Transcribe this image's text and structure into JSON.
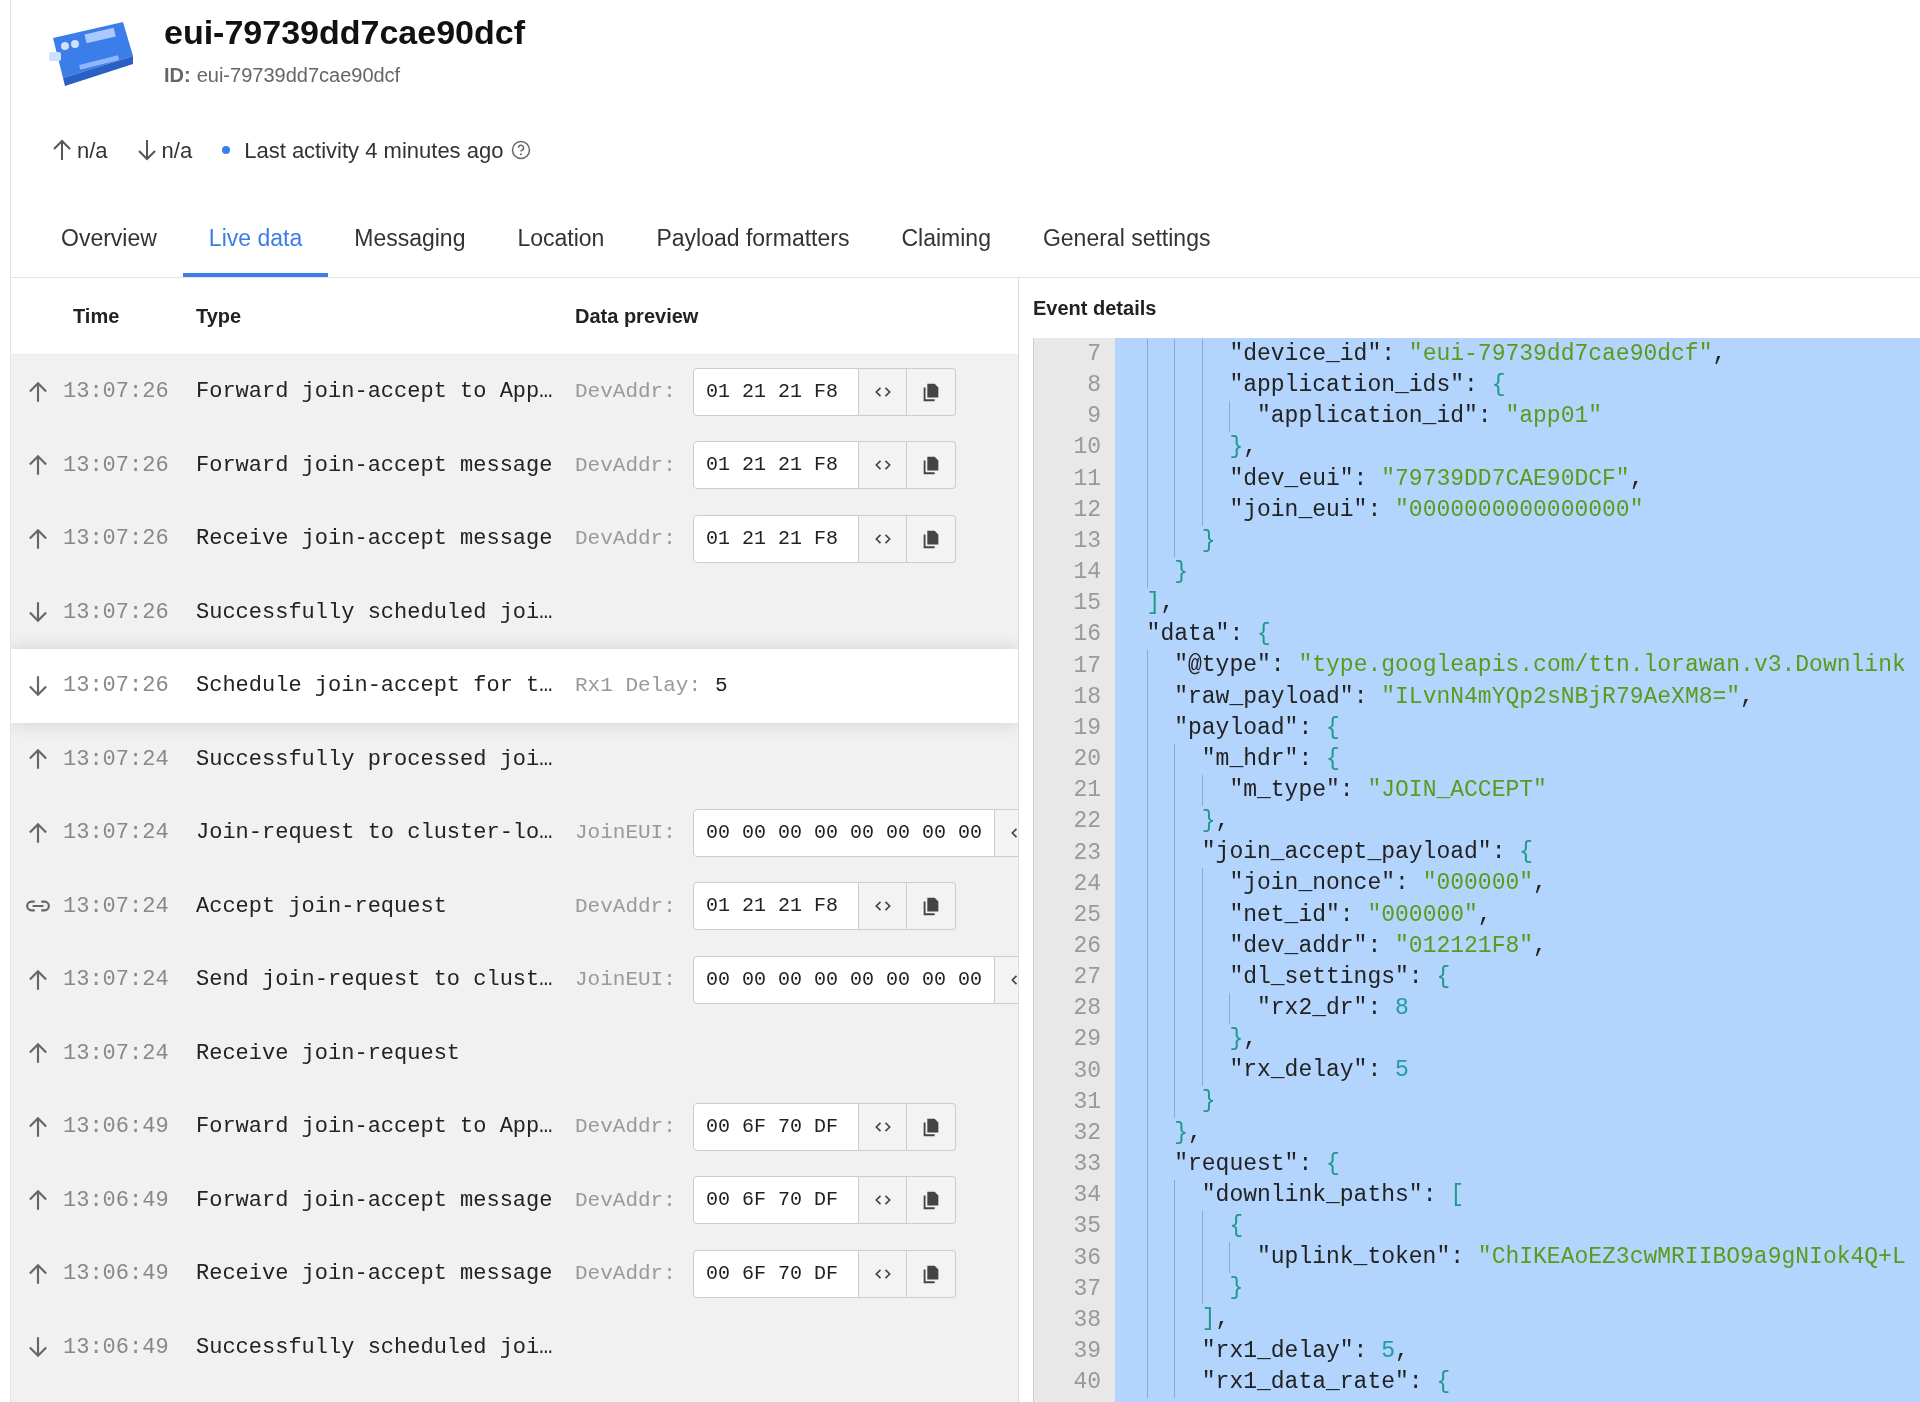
{
  "device": {
    "title": "eui-79739dd7cae90dcf",
    "id_label": "ID:",
    "id_value": "eui-79739dd7cae90dcf"
  },
  "stats": {
    "uplink": "n/a",
    "downlink": "n/a",
    "activity": "Last activity 4 minutes ago"
  },
  "tabs": [
    {
      "label": "Overview",
      "selected": false
    },
    {
      "label": "Live data",
      "selected": true
    },
    {
      "label": "Messaging",
      "selected": false
    },
    {
      "label": "Location",
      "selected": false
    },
    {
      "label": "Payload formatters",
      "selected": false
    },
    {
      "label": "Claiming",
      "selected": false
    },
    {
      "label": "General settings",
      "selected": false
    }
  ],
  "table": {
    "columns": [
      "Time",
      "Type",
      "Data preview"
    ],
    "rows": [
      {
        "kind": "up",
        "time": "13:07:26",
        "type": "Forward join-accept to App…",
        "preview": {
          "kind": "bytes",
          "label": "DevAddr:",
          "value": "01 21 21 F8"
        },
        "selected": false
      },
      {
        "kind": "up",
        "time": "13:07:26",
        "type": "Forward join-accept message",
        "preview": {
          "kind": "bytes",
          "label": "DevAddr:",
          "value": "01 21 21 F8"
        },
        "selected": false
      },
      {
        "kind": "up",
        "time": "13:07:26",
        "type": "Receive join-accept message",
        "preview": {
          "kind": "bytes",
          "label": "DevAddr:",
          "value": "01 21 21 F8"
        },
        "selected": false
      },
      {
        "kind": "down",
        "time": "13:07:26",
        "type": "Successfully scheduled joi…",
        "selected": false
      },
      {
        "kind": "down",
        "time": "13:07:26",
        "type": "Schedule join-accept for t…",
        "preview": {
          "kind": "text",
          "label": "Rx1 Delay:",
          "value": "5"
        },
        "selected": true
      },
      {
        "kind": "up",
        "time": "13:07:24",
        "type": "Successfully processed joi…",
        "selected": false
      },
      {
        "kind": "up",
        "time": "13:07:24",
        "type": "Join-request to cluster-lo…",
        "preview": {
          "kind": "eui",
          "label": "JoinEUI:",
          "value": "00 00 00 00 00 00 00 00"
        },
        "selected": false
      },
      {
        "kind": "link",
        "time": "13:07:24",
        "type": "Accept join-request",
        "preview": {
          "kind": "bytes",
          "label": "DevAddr:",
          "value": "01 21 21 F8"
        },
        "selected": false
      },
      {
        "kind": "up",
        "time": "13:07:24",
        "type": "Send join-request to clust…",
        "preview": {
          "kind": "eui",
          "label": "JoinEUI:",
          "value": "00 00 00 00 00 00 00 00"
        },
        "selected": false
      },
      {
        "kind": "up",
        "time": "13:07:24",
        "type": "Receive join-request",
        "selected": false
      },
      {
        "kind": "up",
        "time": "13:06:49",
        "type": "Forward join-accept to App…",
        "preview": {
          "kind": "bytes",
          "label": "DevAddr:",
          "value": "00 6F 70 DF"
        },
        "selected": false
      },
      {
        "kind": "up",
        "time": "13:06:49",
        "type": "Forward join-accept message",
        "preview": {
          "kind": "bytes",
          "label": "DevAddr:",
          "value": "00 6F 70 DF"
        },
        "selected": false
      },
      {
        "kind": "up",
        "time": "13:06:49",
        "type": "Receive join-accept message",
        "preview": {
          "kind": "bytes",
          "label": "DevAddr:",
          "value": "00 6F 70 DF"
        },
        "selected": false
      },
      {
        "kind": "down",
        "time": "13:06:49",
        "type": "Successfully scheduled joi…",
        "selected": false
      }
    ]
  },
  "event_details": {
    "title": "Event details",
    "lines": [
      {
        "children": [
          {
            "children": [
              {
                "children": [
                  {
                    "number": "7",
                    "tokens": [
                      {
                        "kind": "key",
                        "text": "\"device_id\""
                      },
                      {
                        "kind": "punct",
                        "text": ":"
                      },
                      {
                        "kind": "str",
                        "text": "\"eui-79739dd7cae90dcf\""
                      },
                      {
                        "kind": "punct",
                        "text": ","
                      }
                    ]
                  },
                  {
                    "number": "8",
                    "tokens": [
                      {
                        "kind": "key",
                        "text": "\"application_ids\""
                      },
                      {
                        "kind": "punct",
                        "text": ":"
                      },
                      {
                        "kind": "brace",
                        "text": "{"
                      }
                    ],
                    "children": [
                      {
                        "number": "9",
                        "tokens": [
                          {
                            "kind": "key",
                            "text": "\"application_id\""
                          },
                          {
                            "kind": "punct",
                            "text": ":"
                          },
                          {
                            "kind": "str",
                            "text": "\"app01\""
                          }
                        ]
                      }
                    ]
                  },
                  {
                    "number": "10",
                    "tokens": [
                      {
                        "kind": "brace",
                        "text": "}"
                      },
                      {
                        "kind": "punct",
                        "text": ","
                      }
                    ]
                  },
                  {
                    "number": "11",
                    "tokens": [
                      {
                        "kind": "key",
                        "text": "\"dev_eui\""
                      },
                      {
                        "kind": "punct",
                        "text": ":"
                      },
                      {
                        "kind": "str",
                        "text": "\"79739DD7CAE90DCF\""
                      },
                      {
                        "kind": "punct",
                        "text": ","
                      }
                    ]
                  },
                  {
                    "number": "12",
                    "tokens": [
                      {
                        "kind": "key",
                        "text": "\"join_eui\""
                      },
                      {
                        "kind": "punct",
                        "text": ":"
                      },
                      {
                        "kind": "str",
                        "text": "\"0000000000000000\""
                      }
                    ]
                  }
                ]
              },
              {
                "number": "13",
                "tokens": [
                  {
                    "kind": "brace",
                    "text": "}"
                  }
                ]
              }
            ]
          },
          {
            "number": "14",
            "tokens": [
              {
                "kind": "brace",
                "text": "}"
              }
            ]
          }
        ]
      },
      {
        "number": "15",
        "tokens": [
          {
            "kind": "brace",
            "text": "]"
          },
          {
            "kind": "punct",
            "text": ","
          }
        ]
      },
      {
        "number": "16",
        "tokens": [
          {
            "kind": "key",
            "text": "\"data\""
          },
          {
            "kind": "punct",
            "text": ":"
          },
          {
            "kind": "brace",
            "text": "{"
          }
        ],
        "children": [
          {
            "number": "17",
            "tokens": [
              {
                "kind": "key",
                "text": "\"@type\""
              },
              {
                "kind": "punct",
                "text": ":"
              },
              {
                "kind": "str",
                "text": "\"type.googleapis.com/ttn.lorawan.v3.Downlink"
              }
            ]
          },
          {
            "number": "18",
            "tokens": [
              {
                "kind": "key",
                "text": "\"raw_payload\""
              },
              {
                "kind": "punct",
                "text": ":"
              },
              {
                "kind": "str",
                "text": "\"ILvnN4mYQp2sNBjR79AeXM8=\""
              },
              {
                "kind": "punct",
                "text": ","
              }
            ]
          },
          {
            "number": "19",
            "tokens": [
              {
                "kind": "key",
                "text": "\"payload\""
              },
              {
                "kind": "punct",
                "text": ":"
              },
              {
                "kind": "brace",
                "text": "{"
              }
            ],
            "children": [
              {
                "number": "20",
                "tokens": [
                  {
                    "kind": "key",
                    "text": "\"m_hdr\""
                  },
                  {
                    "kind": "punct",
                    "text": ":"
                  },
                  {
                    "kind": "brace",
                    "text": "{"
                  }
                ],
                "children": [
                  {
                    "number": "21",
                    "tokens": [
                      {
                        "kind": "key",
                        "text": "\"m_type\""
                      },
                      {
                        "kind": "punct",
                        "text": ":"
                      },
                      {
                        "kind": "str",
                        "text": "\"JOIN_ACCEPT\""
                      }
                    ]
                  }
                ]
              },
              {
                "number": "22",
                "tokens": [
                  {
                    "kind": "brace",
                    "text": "}"
                  },
                  {
                    "kind": "punct",
                    "text": ","
                  }
                ]
              },
              {
                "number": "23",
                "tokens": [
                  {
                    "kind": "key",
                    "text": "\"join_accept_payload\""
                  },
                  {
                    "kind": "punct",
                    "text": ":"
                  },
                  {
                    "kind": "brace",
                    "text": "{"
                  }
                ],
                "children": [
                  {
                    "number": "24",
                    "tokens": [
                      {
                        "kind": "key",
                        "text": "\"join_nonce\""
                      },
                      {
                        "kind": "punct",
                        "text": ":"
                      },
                      {
                        "kind": "str",
                        "text": "\"000000\""
                      },
                      {
                        "kind": "punct",
                        "text": ","
                      }
                    ]
                  },
                  {
                    "number": "25",
                    "tokens": [
                      {
                        "kind": "key",
                        "text": "\"net_id\""
                      },
                      {
                        "kind": "punct",
                        "text": ":"
                      },
                      {
                        "kind": "str",
                        "text": "\"000000\""
                      },
                      {
                        "kind": "punct",
                        "text": ","
                      }
                    ]
                  },
                  {
                    "number": "26",
                    "tokens": [
                      {
                        "kind": "key",
                        "text": "\"dev_addr\""
                      },
                      {
                        "kind": "punct",
                        "text": ":"
                      },
                      {
                        "kind": "str",
                        "text": "\"012121F8\""
                      },
                      {
                        "kind": "punct",
                        "text": ","
                      }
                    ]
                  },
                  {
                    "number": "27",
                    "tokens": [
                      {
                        "kind": "key",
                        "text": "\"dl_settings\""
                      },
                      {
                        "kind": "punct",
                        "text": ":"
                      },
                      {
                        "kind": "brace",
                        "text": "{"
                      }
                    ],
                    "children": [
                      {
                        "number": "28",
                        "tokens": [
                          {
                            "kind": "key",
                            "text": "\"rx2_dr\""
                          },
                          {
                            "kind": "punct",
                            "text": ":"
                          },
                          {
                            "kind": "num",
                            "text": "8"
                          }
                        ]
                      }
                    ]
                  },
                  {
                    "number": "29",
                    "tokens": [
                      {
                        "kind": "brace",
                        "text": "}"
                      },
                      {
                        "kind": "punct",
                        "text": ","
                      }
                    ]
                  },
                  {
                    "number": "30",
                    "tokens": [
                      {
                        "kind": "key",
                        "text": "\"rx_delay\""
                      },
                      {
                        "kind": "punct",
                        "text": ":"
                      },
                      {
                        "kind": "num",
                        "text": "5"
                      }
                    ]
                  }
                ]
              },
              {
                "number": "31",
                "tokens": [
                  {
                    "kind": "brace",
                    "text": "}"
                  }
                ]
              }
            ]
          },
          {
            "number": "32",
            "tokens": [
              {
                "kind": "brace",
                "text": "}"
              },
              {
                "kind": "punct",
                "text": ","
              }
            ]
          },
          {
            "number": "33",
            "tokens": [
              {
                "kind": "key",
                "text": "\"request\""
              },
              {
                "kind": "punct",
                "text": ":"
              },
              {
                "kind": "brace",
                "text": "{"
              }
            ],
            "children": [
              {
                "number": "34",
                "tokens": [
                  {
                    "kind": "key",
                    "text": "\"downlink_paths\""
                  },
                  {
                    "kind": "punct",
                    "text": ":"
                  },
                  {
                    "kind": "brace",
                    "text": "["
                  }
                ],
                "children": [
                  {
                    "number": "35",
                    "tokens": [
                      {
                        "kind": "brace",
                        "text": "{"
                      }
                    ],
                    "children": [
                      {
                        "number": "36",
                        "tokens": [
                          {
                            "kind": "key",
                            "text": "\"uplink_token\""
                          },
                          {
                            "kind": "punct",
                            "text": ":"
                          },
                          {
                            "kind": "str",
                            "text": "\"ChIKEAoEZ3cwMRIIBO9a9gNIok4Q+L"
                          }
                        ]
                      }
                    ]
                  },
                  {
                    "number": "37",
                    "tokens": [
                      {
                        "kind": "brace",
                        "text": "}"
                      }
                    ]
                  }
                ]
              },
              {
                "number": "38",
                "tokens": [
                  {
                    "kind": "brace",
                    "text": "]"
                  },
                  {
                    "kind": "punct",
                    "text": ","
                  }
                ]
              },
              {
                "number": "39",
                "tokens": [
                  {
                    "kind": "key",
                    "text": "\"rx1_delay\""
                  },
                  {
                    "kind": "punct",
                    "text": ":"
                  },
                  {
                    "kind": "num",
                    "text": "5"
                  },
                  {
                    "kind": "punct",
                    "text": ","
                  }
                ]
              },
              {
                "number": "40",
                "tokens": [
                  {
                    "kind": "key",
                    "text": "\"rx1_data_rate\""
                  },
                  {
                    "kind": "punct",
                    "text": ":"
                  },
                  {
                    "kind": "brace",
                    "text": "{"
                  }
                ]
              }
            ]
          }
        ]
      }
    ]
  }
}
